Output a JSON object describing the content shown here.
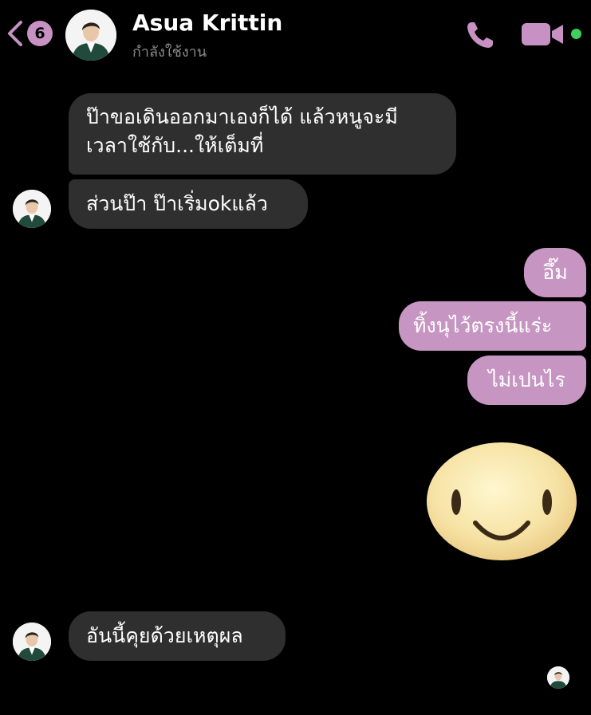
{
  "header": {
    "back_badge_count": "6",
    "contact_name": "Asua Krittin",
    "contact_status": "กำลังใช้งาน",
    "accent_color": "#c792c3",
    "online_color": "#3fcf5c",
    "icons": [
      "chevron-left-icon",
      "phone-icon",
      "video-camera-icon"
    ]
  },
  "messages": [
    {
      "direction": "incoming",
      "lines": [
        "ป๊าขอเดินออกมาเองก็ได้ แล้วหนูจะมี",
        "เวลาใช้กับ...ให้เต็มที่"
      ]
    },
    {
      "direction": "incoming",
      "text": "ส่วนป๊า ป๊าเริ่มokแล้ว",
      "show_avatar": true
    },
    {
      "direction": "outgoing",
      "text": "อึ๊ม"
    },
    {
      "direction": "outgoing",
      "text": "ทิ้งนุไว้ตรงนี้แร่ะ"
    },
    {
      "direction": "outgoing",
      "text": "ไม่เปนไร"
    },
    {
      "direction": "outgoing",
      "type": "sticker",
      "sticker": "smiley-face-sticker"
    },
    {
      "direction": "incoming",
      "text": "อันนี้คุยด้วยเหตุผล",
      "show_avatar": true
    }
  ],
  "colors": {
    "background": "#000000",
    "incoming_bubble": "#2f2f2f",
    "outgoing_bubble": "#c795c2"
  }
}
